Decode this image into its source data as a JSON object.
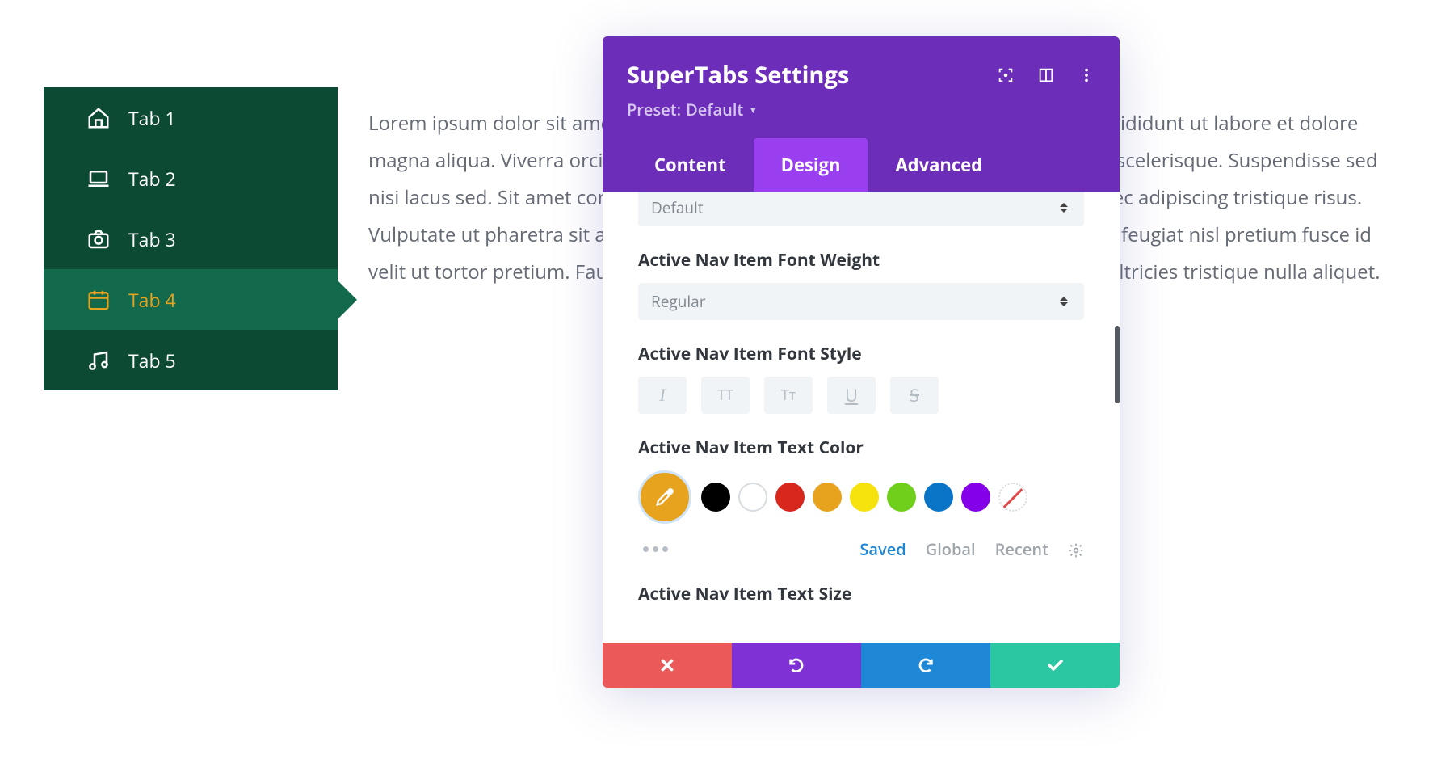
{
  "sidebar": {
    "items": [
      {
        "label": "Tab 1",
        "icon": "home-icon"
      },
      {
        "label": "Tab 2",
        "icon": "laptop-icon"
      },
      {
        "label": "Tab 3",
        "icon": "camera-icon"
      },
      {
        "label": "Tab 4",
        "icon": "calendar-icon",
        "active": true
      },
      {
        "label": "Tab 5",
        "icon": "music-icon"
      }
    ]
  },
  "body_text": "Lorem ipsum dolor sit amet, consectetur adipiscing elit, sed do eiusmod tempor incididunt ut labore et dolore magna aliqua. Viverra orci sagittis eu volutpat odio facilisis. In tellus integer feugiat scelerisque. Suspendisse sed nisi lacus sed. Sit amet consectetur adipiscing elit. Aenean sed adipiscing diam donec adipiscing tristique risus. Vulputate ut pharetra sit amet aliquam. Ornare suspendisse sed nisi lacus sed. Nec feugiat nisl pretium fusce id velit ut tortor pretium. Faucibus vitae aliquet nec ullamcorper sit. Lorem sed risus ultricies tristique nulla aliquet.",
  "modal": {
    "title": "SuperTabs Settings",
    "preset_label": "Preset:",
    "preset_value": "Default",
    "tabs": [
      {
        "label": "Content"
      },
      {
        "label": "Design",
        "active": true
      },
      {
        "label": "Advanced"
      }
    ],
    "fields": {
      "partial_select_value": "Default",
      "font_weight_label": "Active Nav Item Font Weight",
      "font_weight_value": "Regular",
      "font_style_label": "Active Nav Item Font Style",
      "text_color_label": "Active Nav Item Text Color",
      "text_size_label": "Active Nav Item Text Size"
    },
    "style_toggles": [
      {
        "name": "italic",
        "glyph": "I"
      },
      {
        "name": "uppercase",
        "glyph": "TT"
      },
      {
        "name": "small-caps",
        "glyph": "Tᴛ"
      },
      {
        "name": "underline",
        "glyph": "U"
      },
      {
        "name": "strikethrough",
        "glyph": "S"
      }
    ],
    "color_swatches": [
      {
        "name": "black",
        "hex": "#000000"
      },
      {
        "name": "white",
        "hex": "#ffffff",
        "border": "#d8dce0"
      },
      {
        "name": "red",
        "hex": "#d8271d"
      },
      {
        "name": "orange",
        "hex": "#e7a21e"
      },
      {
        "name": "yellow",
        "hex": "#f6e20d"
      },
      {
        "name": "green",
        "hex": "#6fcf1b"
      },
      {
        "name": "blue",
        "hex": "#0a74c7"
      },
      {
        "name": "purple",
        "hex": "#8300e9"
      },
      {
        "name": "none",
        "hex": null
      }
    ],
    "eyedropper_color": "#e7a21e",
    "saved_tabs": {
      "saved": "Saved",
      "global": "Global",
      "recent": "Recent"
    },
    "colors": {
      "saved_active": "#1e87d6",
      "saved_inactive": "#9ea5ab"
    }
  }
}
